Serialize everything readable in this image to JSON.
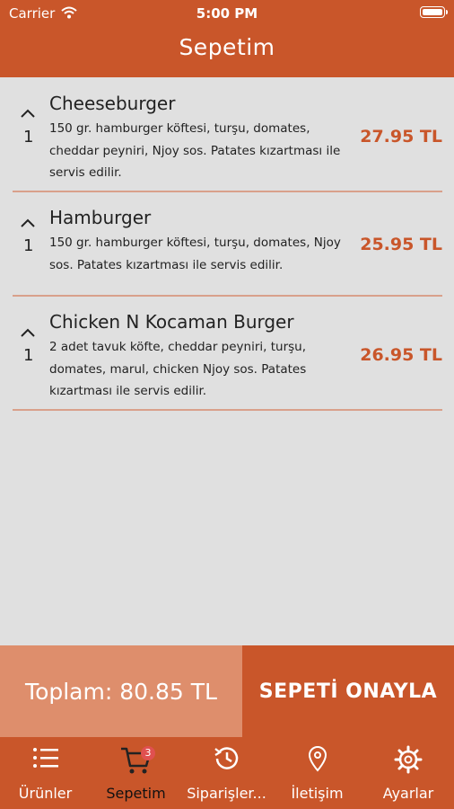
{
  "status_bar": {
    "carrier": "Carrier",
    "time": "5:00 PM"
  },
  "header": {
    "title": "Sepetim"
  },
  "cart": {
    "items": [
      {
        "name": "Cheeseburger",
        "quantity": "1",
        "description": "150 gr. hamburger köftesi, turşu, domates, cheddar peyniri, Njoy sos. Patates kızartması ile servis edilir.",
        "price": "27.95 TL"
      },
      {
        "name": "Hamburger",
        "quantity": "1",
        "description": "150 gr. hamburger köftesi, turşu, domates, Njoy sos. Patates kızartması ile servis edilir.",
        "price": "25.95 TL"
      },
      {
        "name": "Chicken N Kocaman Burger",
        "quantity": "1",
        "description": "2 adet tavuk köfte, cheddar peyniri, turşu, domates, marul, chicken Njoy sos. Patates kızartması ile servis edilir.",
        "price": "26.95 TL"
      }
    ]
  },
  "footer": {
    "total": "Toplam: 80.85 TL",
    "confirm": "SEPETİ ONAYLA"
  },
  "tabbar": {
    "items": [
      {
        "label": "Ürünler",
        "icon": "list-icon"
      },
      {
        "label": "Sepetim",
        "icon": "cart-icon",
        "badge": "3"
      },
      {
        "label": "Siparişler...",
        "icon": "history-icon"
      },
      {
        "label": "İletişim",
        "icon": "location-pin-icon"
      },
      {
        "label": "Ayarlar",
        "icon": "gear-icon"
      }
    ]
  },
  "colors": {
    "primary": "#c9562a",
    "total_bg": "#de8e6c",
    "background": "#e0e0e0",
    "divider": "#d9a08b",
    "badge": "#e05050"
  }
}
